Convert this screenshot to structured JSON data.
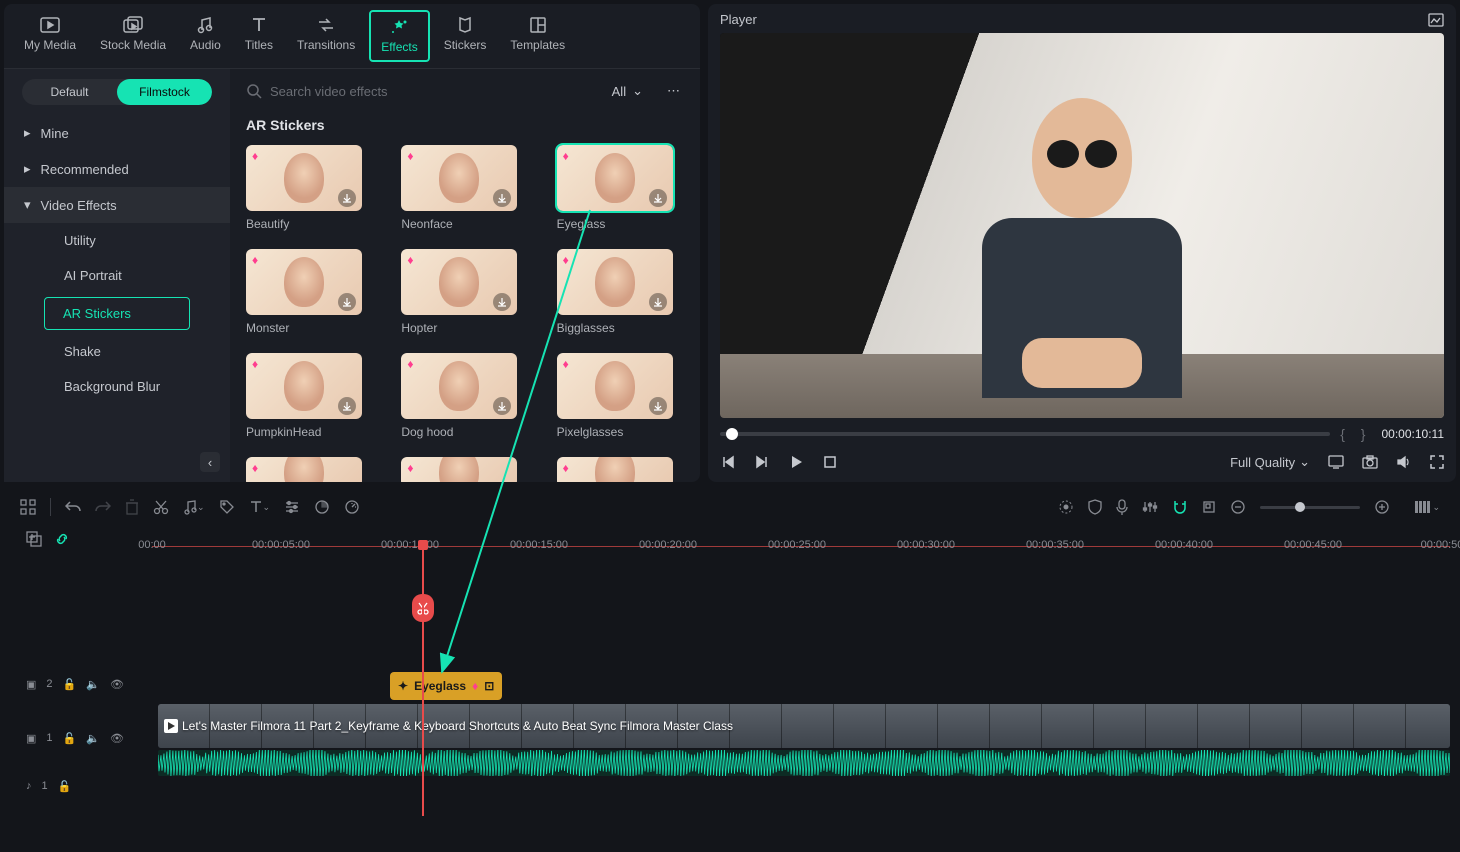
{
  "nav": {
    "tabs": [
      {
        "id": "my-media",
        "label": "My Media"
      },
      {
        "id": "stock-media",
        "label": "Stock Media"
      },
      {
        "id": "audio",
        "label": "Audio"
      },
      {
        "id": "titles",
        "label": "Titles"
      },
      {
        "id": "transitions",
        "label": "Transitions"
      },
      {
        "id": "effects",
        "label": "Effects",
        "active": true
      },
      {
        "id": "stickers",
        "label": "Stickers"
      },
      {
        "id": "templates",
        "label": "Templates"
      }
    ]
  },
  "sidebar": {
    "tabs": {
      "default": "Default",
      "filmstock": "Filmstock"
    },
    "items": [
      {
        "label": "Mine",
        "expanded": false
      },
      {
        "label": "Recommended",
        "expanded": false
      },
      {
        "label": "Video Effects",
        "expanded": true,
        "children": [
          {
            "label": "Utility"
          },
          {
            "label": "AI Portrait"
          },
          {
            "label": "AR Stickers",
            "active": true
          },
          {
            "label": "Shake"
          },
          {
            "label": "Background Blur"
          }
        ]
      }
    ]
  },
  "search": {
    "placeholder": "Search video effects",
    "filter": "All"
  },
  "section": {
    "title": "AR Stickers",
    "items": [
      {
        "label": "Beautify"
      },
      {
        "label": "Neonface"
      },
      {
        "label": "Eyeglass",
        "selected": true
      },
      {
        "label": "Monster"
      },
      {
        "label": "Hopter"
      },
      {
        "label": "Bigglasses"
      },
      {
        "label": "PumpkinHead"
      },
      {
        "label": "Dog hood"
      },
      {
        "label": "Pixelglasses"
      }
    ]
  },
  "player": {
    "title": "Player",
    "timecode": "00:00:10:11",
    "quality": "Full Quality"
  },
  "timeline": {
    "ruler": [
      "00:00",
      "00:00:05:00",
      "00:00:10:00",
      "00:00:15:00",
      "00:00:20:00",
      "00:00:25:00",
      "00:00:30:00",
      "00:00:35:00",
      "00:00:40:00",
      "00:00:45:00",
      "00:00:50"
    ],
    "effect_clip": "Eyeglass",
    "video_clip": "Let's Master Filmora 11 Part 2_Keyframe & Keyboard Shortcuts & Auto Beat Sync   Filmora Master Class",
    "tracks": {
      "video2": "2",
      "video1": "1",
      "audio1": "1"
    }
  }
}
